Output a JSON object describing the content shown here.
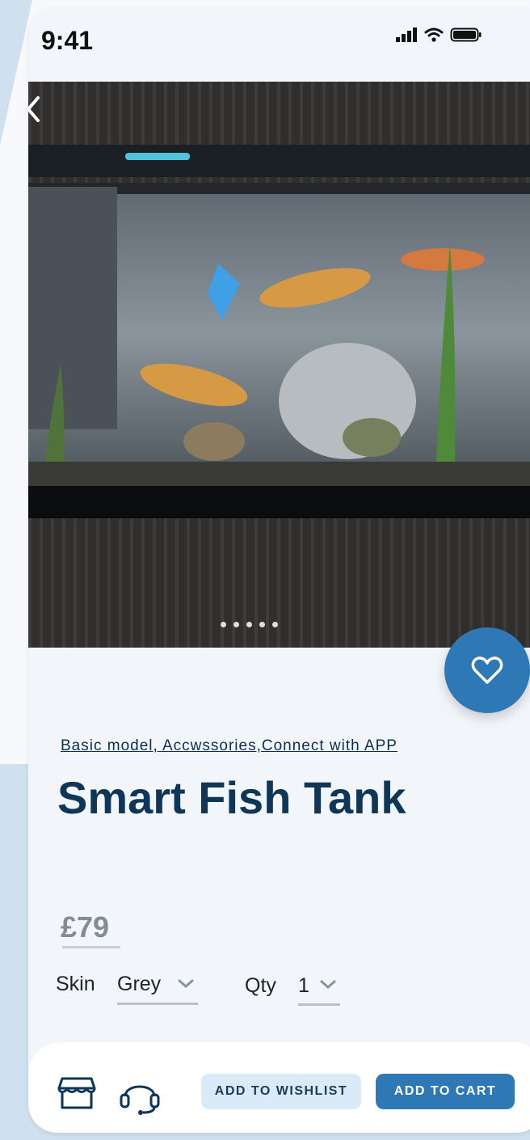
{
  "status_bar": {
    "time": "9:41"
  },
  "hero": {
    "image_alt": "Smart fish tank with display strip showing 19:20",
    "carousel_dots": 5
  },
  "product": {
    "subtitle": "Basic model, Accwssories,Connect with APP",
    "title": "Smart Fish Tank",
    "price": "£79"
  },
  "options": {
    "skin_label": "Skin",
    "skin_value": "Grey",
    "qty_label": "Qty",
    "qty_value": "1"
  },
  "actions": {
    "wishlist_label": "ADD TO WISHLIST",
    "cart_label": "ADD TO CART"
  },
  "icons": [
    "back-icon",
    "heart-icon",
    "chevron-down-icon",
    "store-icon",
    "headset-icon",
    "signal-icon",
    "wifi-icon",
    "battery-icon"
  ],
  "colors": {
    "accent": "#2f78b6",
    "title": "#0f3557",
    "wishlist_bg": "#d9eaf8"
  }
}
